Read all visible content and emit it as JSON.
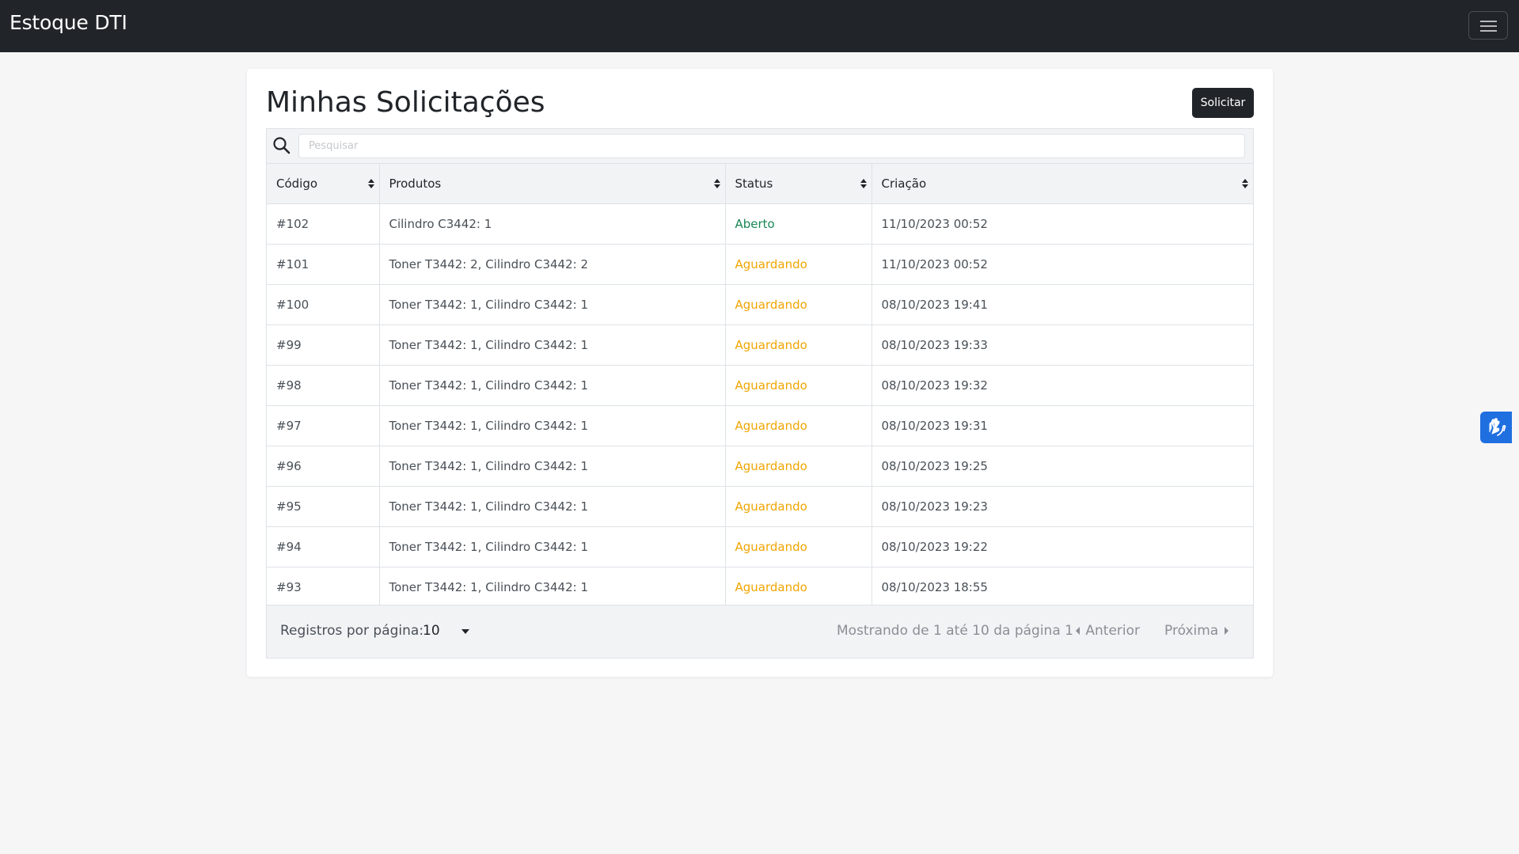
{
  "app": {
    "brand": "Estoque DTI"
  },
  "page": {
    "title": "Minhas Solicitações",
    "action_button": "Solicitar"
  },
  "search": {
    "placeholder": "Pesquisar"
  },
  "table": {
    "columns": [
      "Código",
      "Produtos",
      "Status",
      "Criação"
    ],
    "rows": [
      {
        "codigo": "#102",
        "produtos": "Cilindro C3442: 1",
        "status": "Aberto",
        "criacao": "11/10/2023 00:52"
      },
      {
        "codigo": "#101",
        "produtos": "Toner T3442: 2, Cilindro C3442: 2",
        "status": "Aguardando",
        "criacao": "11/10/2023 00:52"
      },
      {
        "codigo": "#100",
        "produtos": "Toner T3442: 1, Cilindro C3442: 1",
        "status": "Aguardando",
        "criacao": "08/10/2023 19:41"
      },
      {
        "codigo": "#99",
        "produtos": "Toner T3442: 1, Cilindro C3442: 1",
        "status": "Aguardando",
        "criacao": "08/10/2023 19:33"
      },
      {
        "codigo": "#98",
        "produtos": "Toner T3442: 1, Cilindro C3442: 1",
        "status": "Aguardando",
        "criacao": "08/10/2023 19:32"
      },
      {
        "codigo": "#97",
        "produtos": "Toner T3442: 1, Cilindro C3442: 1",
        "status": "Aguardando",
        "criacao": "08/10/2023 19:31"
      },
      {
        "codigo": "#96",
        "produtos": "Toner T3442: 1, Cilindro C3442: 1",
        "status": "Aguardando",
        "criacao": "08/10/2023 19:25"
      },
      {
        "codigo": "#95",
        "produtos": "Toner T3442: 1, Cilindro C3442: 1",
        "status": "Aguardando",
        "criacao": "08/10/2023 19:23"
      },
      {
        "codigo": "#94",
        "produtos": "Toner T3442: 1, Cilindro C3442: 1",
        "status": "Aguardando",
        "criacao": "08/10/2023 19:22"
      },
      {
        "codigo": "#93",
        "produtos": "Toner T3442: 1, Cilindro C3442: 1",
        "status": "Aguardando",
        "criacao": "08/10/2023 18:55"
      }
    ]
  },
  "pagination": {
    "rows_per_page_label": "Registros por página:",
    "rows_per_page_value": "10",
    "info": "Mostrando de 1 até 10 da página 1",
    "prev_label": "Anterior",
    "next_label": "Próxima"
  },
  "colors": {
    "navbar": "#212529",
    "status_open": "#198754",
    "status_waiting": "#f0a500",
    "accessibility_widget": "#1f6fe0"
  },
  "icons": {
    "menu": "hamburger-menu-icon",
    "search": "search-icon",
    "sort": "sort-icon",
    "dropdown": "caret-down-icon",
    "prev": "caret-left-icon",
    "next": "caret-right-icon",
    "accessibility": "sign-language-hands-icon"
  }
}
